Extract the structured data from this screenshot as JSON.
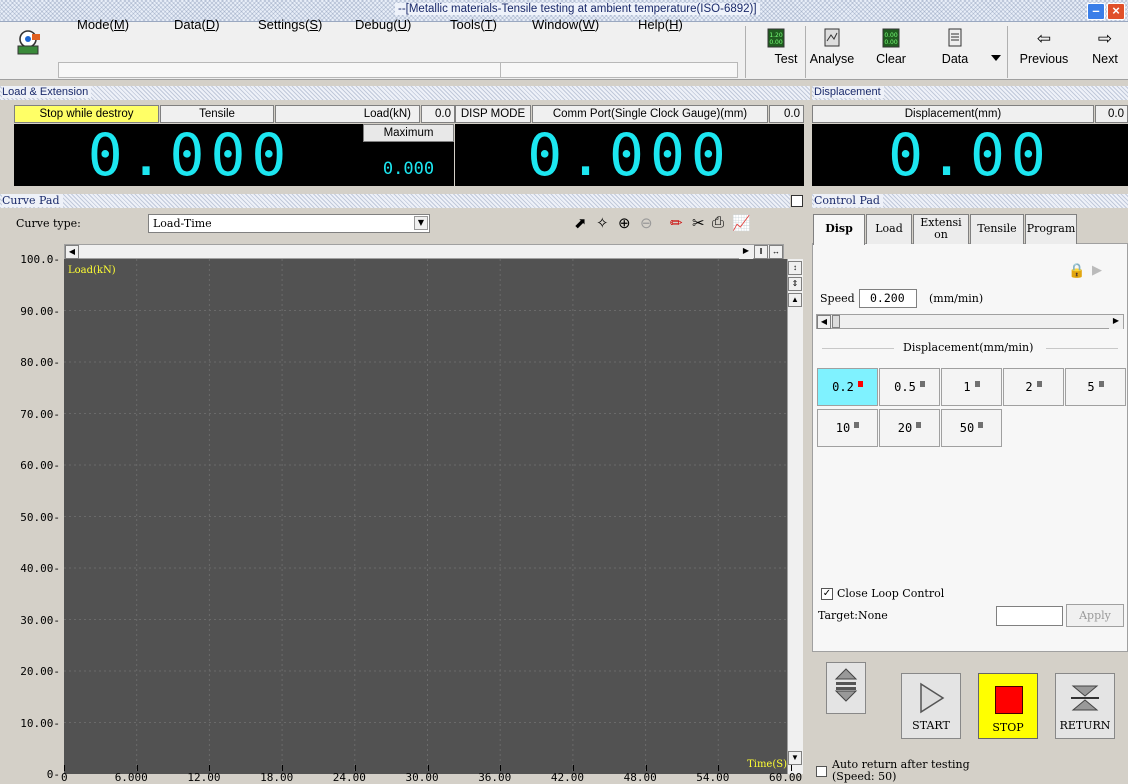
{
  "title": "--[Metallic materials-Tensile testing at ambient temperature(ISO-6892)]",
  "menu": [
    "Mode(M)",
    "Data(D)",
    "Settings(S)",
    "Debug(U)",
    "Tools(T)",
    "Window(W)",
    "Help(H)"
  ],
  "menu_parts": [
    {
      "pre": "Mode(",
      "key": "M",
      "post": ")"
    },
    {
      "pre": "Data(",
      "key": "D",
      "post": ")"
    },
    {
      "pre": "Settings(",
      "key": "S",
      "post": ")"
    },
    {
      "pre": "Debug(",
      "key": "U",
      "post": ")"
    },
    {
      "pre": "Tools(",
      "key": "T",
      "post": ")"
    },
    {
      "pre": "Window(",
      "key": "W",
      "post": ")"
    },
    {
      "pre": "Help(",
      "key": "H",
      "post": ")"
    }
  ],
  "toolbar": {
    "test": "Test",
    "analyse": "Analyse",
    "clear": "Clear",
    "data": "Data",
    "previous": "Previous",
    "next": "Next"
  },
  "load_panel": {
    "title": "Load & Extension",
    "stop_mode": "Stop while destroy",
    "test_type": "Tensile",
    "load_label": "Load(kN)",
    "load_value": "0.0",
    "maximum_label": "Maximum",
    "maximum_value": "0.000",
    "load_display": "0.000",
    "disp_mode": "DISP MODE",
    "comm_port": "Comm Port(Single Clock Gauge)(mm)",
    "comm_value": "0.0",
    "ext_display": "0.000"
  },
  "disp_panel": {
    "title": "Displacement",
    "label": "Displacement(mm)",
    "value": "0.0",
    "display": "0.00"
  },
  "curve_pad": {
    "title": "Curve Pad",
    "curve_type_label": "Curve type:",
    "curve_type_value": "Load-Time",
    "y_axis_label": "Load(kN)",
    "x_axis_label": "Time(S)",
    "y_ticks": [
      "100.0-",
      "90.00-",
      "80.00-",
      "70.00-",
      "60.00-",
      "50.00-",
      "40.00-",
      "30.00-",
      "20.00-",
      "10.00-",
      "0-"
    ],
    "x_ticks": [
      "0",
      "6.000",
      "12.00",
      "18.00",
      "24.00",
      "30.00",
      "36.00",
      "42.00",
      "48.00",
      "54.00",
      "60.00"
    ]
  },
  "control_pad": {
    "title": "Control Pad",
    "tabs": [
      "Disp",
      "Load",
      "Extensi on",
      "Tensile",
      "Program"
    ],
    "speed_label": "Speed",
    "speed_value": "0.200",
    "speed_unit": "(mm/min)",
    "group_label": "Displacement(mm/min)",
    "speeds": [
      "0.2",
      "0.5",
      "1",
      "2",
      "5",
      "10",
      "20",
      "50"
    ],
    "selected_speed": "0.2",
    "close_loop_label": "Close Loop Control",
    "close_loop_checked": true,
    "target_label": "Target:None",
    "apply_label": "Apply",
    "start_label": "START",
    "stop_label": "STOP",
    "return_label": "RETURN",
    "auto_return_label": "Auto return after testing",
    "auto_return_speed": "(Speed: 50)"
  },
  "colors": {
    "lcd_digits": "#1ce6f0",
    "plot_bg": "#525252",
    "highlight_yellow": "#ffff66",
    "selected_speed": "#7ff2ff",
    "stop_red": "#ff0000",
    "stop_bg": "#ffff00"
  }
}
